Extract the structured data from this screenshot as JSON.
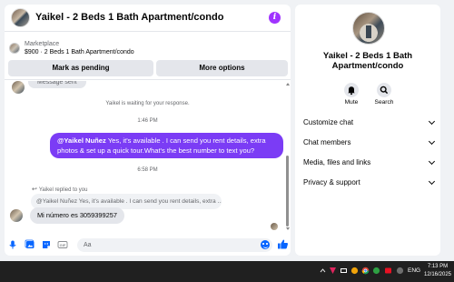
{
  "header": {
    "title": "Yaikel - 2 Beds 1 Bath Apartment/condo"
  },
  "listing": {
    "label": "Marketplace",
    "detail": "$900 · 2 Beds 1 Bath Apartment/condo",
    "pending_button": "Mark as pending",
    "more_button": "More options"
  },
  "messages": {
    "partial_text": "Message sent",
    "waiting": "Yaikel is waiting for your response.",
    "time1": "1:46 PM",
    "sent_mention": "@Yaikel Nuñez",
    "sent_text": " Yes, it's available . I can send you rent details, extra photos & set up a quick tour.What's the best number to text you?",
    "time2": "6:58 PM",
    "replied_label": "Yaikel replied to you",
    "quoted_text": "@Yaikel Nuñez Yes, it's available . I can send you rent details, extra ...",
    "received_text": "Mi número es 3059399257"
  },
  "composer": {
    "placeholder": "Aa"
  },
  "details": {
    "name": "Yaikel - 2 Beds 1 Bath Apartment/condo",
    "mute_label": "Mute",
    "search_label": "Search",
    "sections": [
      "Customize chat",
      "Chat members",
      "Media, files and links",
      "Privacy & support"
    ]
  },
  "taskbar": {
    "language": "ENG",
    "time": "7:13 PM",
    "date": "12/16/2025"
  },
  "colors": {
    "accent": "#0866ff",
    "sent_bubble": "#7b3cf5",
    "info_icon": "#a033ff"
  }
}
